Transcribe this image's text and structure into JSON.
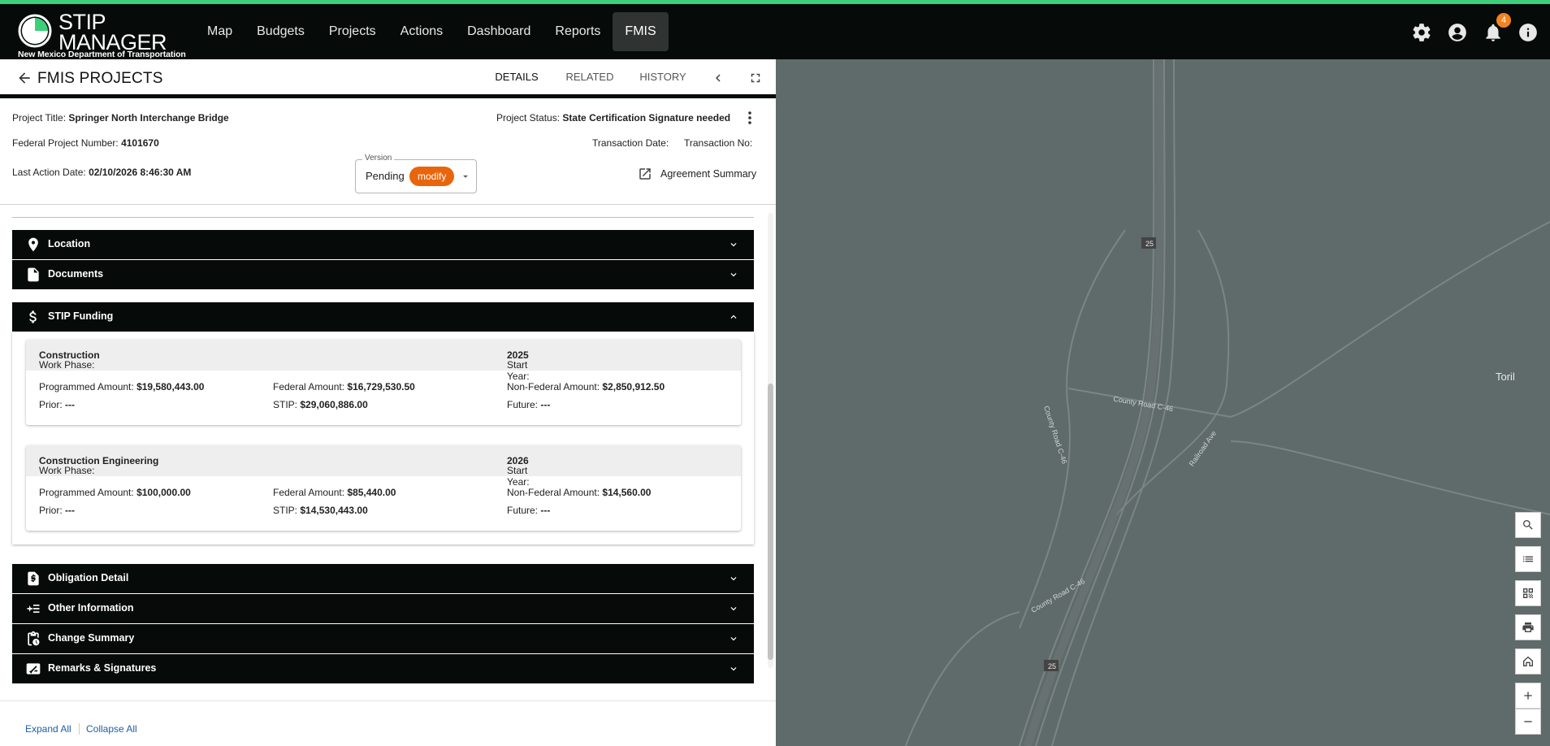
{
  "app": {
    "logo_title_line1": "STIP",
    "logo_title_line2": "MANAGER",
    "logo_subtitle": "New Mexico Department of Transportation",
    "nav": [
      "Map",
      "Budgets",
      "Projects",
      "Actions",
      "Dashboard",
      "Reports",
      "FMIS"
    ],
    "active_nav": "FMIS",
    "notification_count": "4",
    "accent_color": "#3ecf7a",
    "chip_color": "#e8650c"
  },
  "panel": {
    "title": "FMIS PROJECTS",
    "tabs": [
      "DETAILS",
      "RELATED",
      "HISTORY"
    ],
    "active_tab": "DETAILS"
  },
  "project": {
    "title_label": "Project Title:",
    "title_value": "Springer North Interchange Bridge",
    "federal_number_label": "Federal Project Number:",
    "federal_number_value": "4101670",
    "last_action_label": "Last Action Date:",
    "last_action_value": "02/10/2026 8:46:30 AM",
    "status_label": "Project Status:",
    "status_value": "State Certification Signature needed",
    "transaction_date_label": "Transaction Date:",
    "transaction_no_label": "Transaction No:",
    "version_label": "Version",
    "version_value": "Pending",
    "version_chip": "modify",
    "agreement_summary": "Agreement Summary"
  },
  "sections": {
    "location": "Location",
    "documents": "Documents",
    "stip_funding": "STIP Funding",
    "obligation_detail": "Obligation Detail",
    "other_information": "Other Information",
    "change_summary": "Change Summary",
    "remarks_signatures": "Remarks & Signatures"
  },
  "labels": {
    "work_phase": "Work Phase:",
    "start_year": "Start Year:",
    "programmed": "Programmed Amount:",
    "federal": "Federal Amount:",
    "non_federal": "Non-Federal Amount:",
    "prior": "Prior:",
    "stip": "STIP:",
    "future": "Future:"
  },
  "phases": [
    {
      "work_phase": "Construction",
      "start_year": "2025",
      "programmed": "$19,580,443.00",
      "federal": "$16,729,530.50",
      "non_federal": "$2,850,912.50",
      "prior": "---",
      "stip": "$29,060,886.00",
      "future": "---"
    },
    {
      "work_phase": "Construction Engineering",
      "start_year": "2026",
      "programmed": "$100,000.00",
      "federal": "$85,440.00",
      "non_federal": "$14,560.00",
      "prior": "---",
      "stip": "$14,530,443.00",
      "future": "---"
    }
  ],
  "footer": {
    "expand_all": "Expand All",
    "collapse_all": "Collapse All"
  },
  "map": {
    "labels": {
      "town": "Toril",
      "county_road_c46": "County Road C-46",
      "railroad_ave": "Railroad Ave",
      "route_25": "25"
    },
    "tools": [
      "search-icon",
      "legend-icon",
      "qr-icon",
      "print-icon",
      "home-icon",
      "zoom-in-icon",
      "zoom-out-icon"
    ]
  }
}
